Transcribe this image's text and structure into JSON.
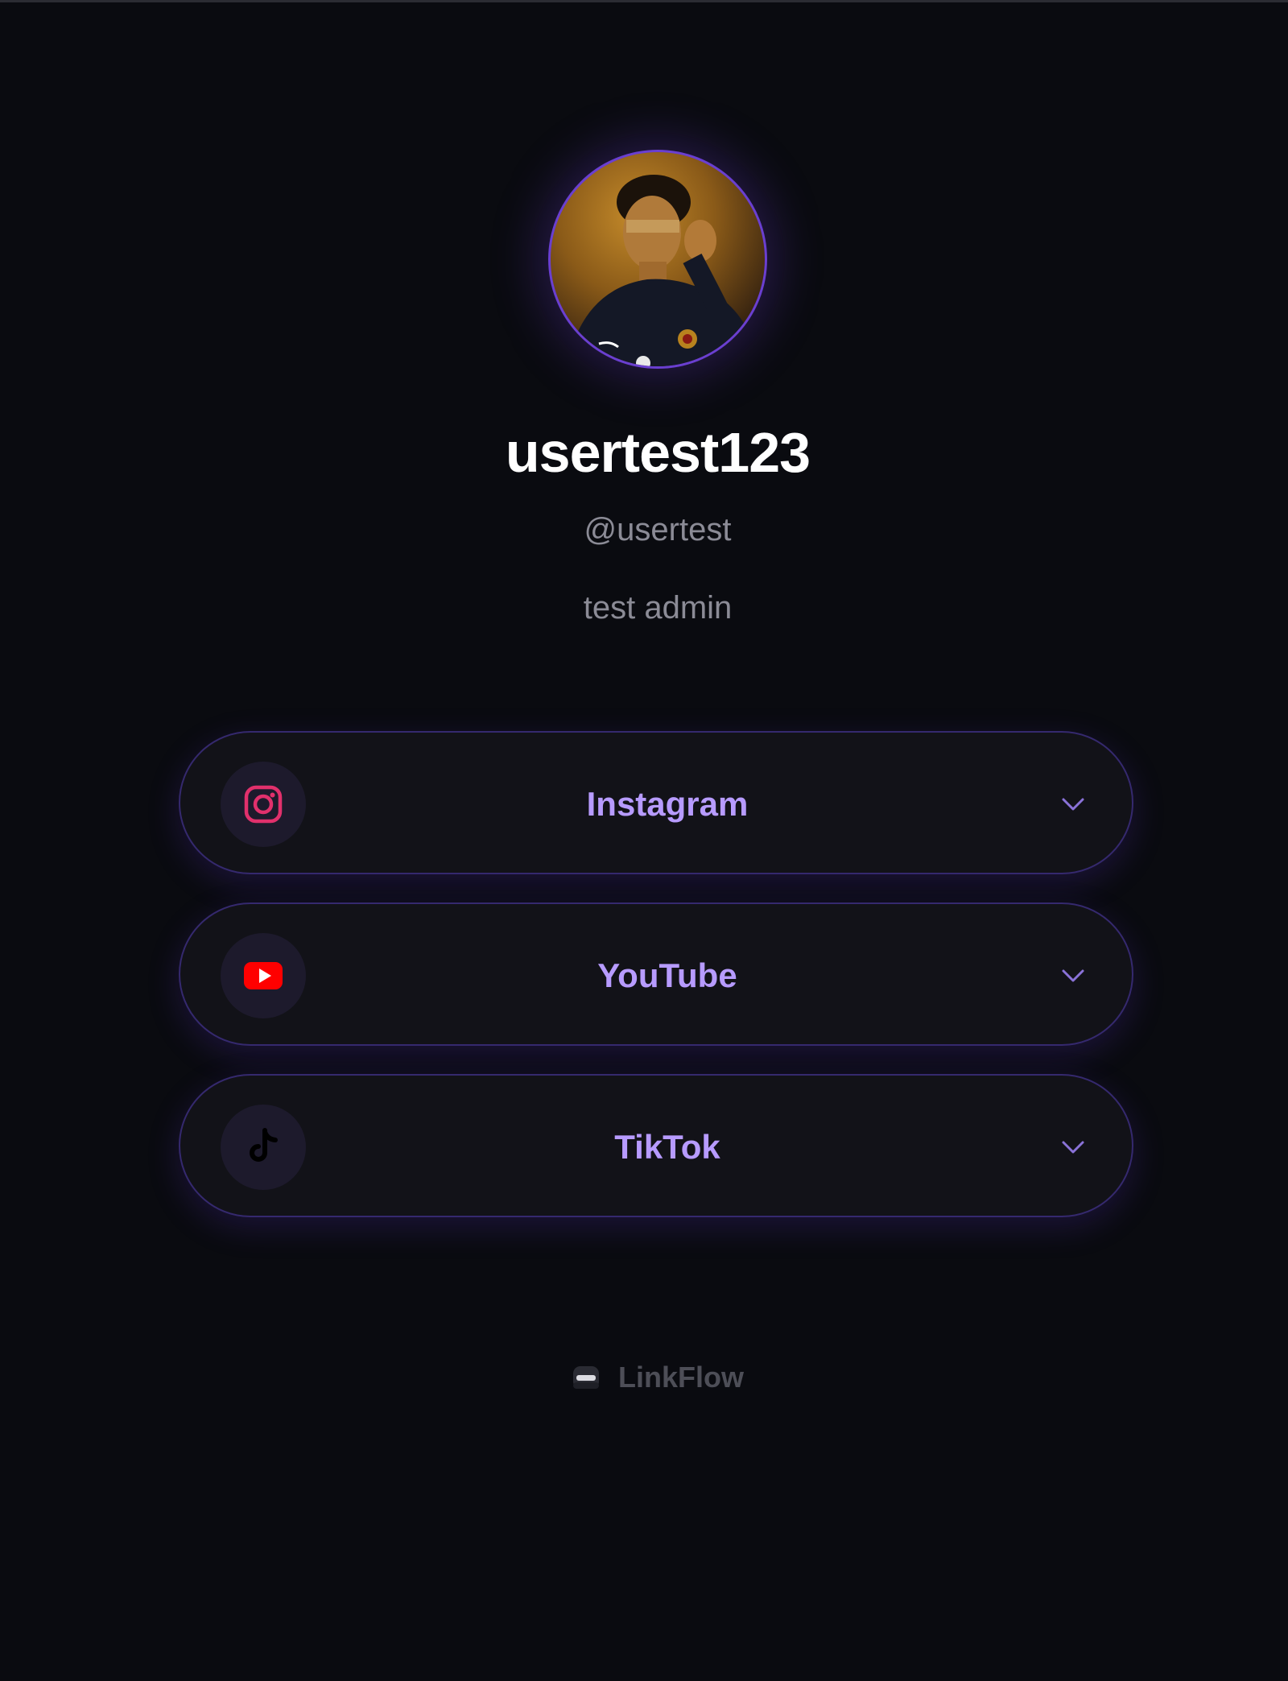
{
  "profile": {
    "display_name": "usertest123",
    "handle": "@usertest",
    "bio": "test admin",
    "avatar_desc": "avatar"
  },
  "links": [
    {
      "label": "Instagram",
      "icon": "instagram-icon",
      "icon_color": "#e1306c"
    },
    {
      "label": "YouTube",
      "icon": "youtube-icon",
      "icon_color": "#ff0000"
    },
    {
      "label": "TikTok",
      "icon": "tiktok-icon",
      "icon_color": "#000000"
    }
  ],
  "footer": {
    "brand": "LinkFlow"
  },
  "colors": {
    "background": "#0a0b10",
    "accent": "#b79bff",
    "card_border": "#35296e"
  }
}
